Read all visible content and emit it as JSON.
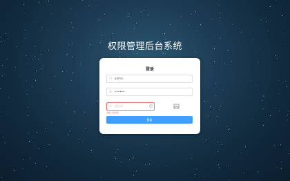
{
  "app_title": "权限管理后台系统",
  "login": {
    "heading": "登录",
    "username": {
      "value": "admin"
    },
    "password": {
      "value": "••••••"
    },
    "captcha": {
      "placeholder": "验证码",
      "error": "请输入验证码",
      "image_alt": "验证码"
    },
    "submit_label": "登录"
  },
  "icons": {
    "user": "user-icon",
    "lock": "lock-icon",
    "shield": "shield-icon",
    "clear": "clear-icon"
  },
  "colors": {
    "primary": "#409eff",
    "error": "#f56c6c"
  }
}
